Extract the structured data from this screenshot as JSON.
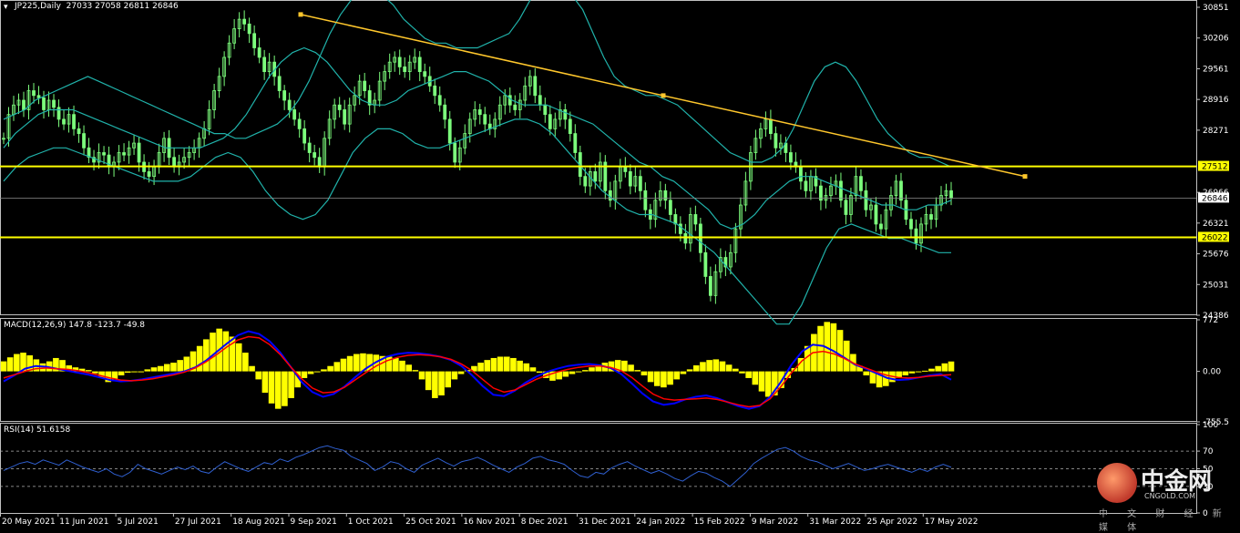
{
  "colors": {
    "background": "#000000",
    "candles": "#7CFC7C",
    "bands": "#20B2AA",
    "levels": "#FFFF00",
    "trendline": "#FFC72C",
    "macd_hist": "#FFFF00",
    "macd_line": "#0000FF",
    "signal_line": "#FF0000",
    "rsi_line": "#2F5FCF"
  },
  "chart_data": [
    {
      "type": "candlestick",
      "title": "JP225,Daily  27033 27058 26811 26846",
      "symbol": "JP225,Daily",
      "ohlc_text": "27033 27058 26811 26846",
      "y_ticks": [
        "30851",
        "30206",
        "29561",
        "28916",
        "28271",
        "27512",
        "26966",
        "26846",
        "26321",
        "26022",
        "25676",
        "25031",
        "24386"
      ],
      "ylim": [
        24386,
        30851
      ],
      "x_ticks": [
        "20 May 2021",
        "11 Jun 2021",
        "5 Jul 2021",
        "27 Jul 2021",
        "18 Aug 2021",
        "9 Sep 2021",
        "1 Oct 2021",
        "25 Oct 2021",
        "16 Nov 2021",
        "8 Dec 2021",
        "31 Dec 2021",
        "24 Jan 2022",
        "15 Feb 2022",
        "9 Mar 2022",
        "31 Mar 2022",
        "25 Apr 2022",
        "17 May 2022"
      ],
      "close_series": [
        28100,
        28600,
        28800,
        28900,
        28700,
        29100,
        29000,
        28950,
        28700,
        28900,
        28750,
        28500,
        28400,
        28600,
        28300,
        28200,
        27900,
        27700,
        27600,
        27800,
        27750,
        27500,
        27600,
        27800,
        27750,
        27900,
        28000,
        27600,
        27400,
        27300,
        27500,
        27800,
        28100,
        27700,
        27500,
        27600,
        27700,
        27800,
        27900,
        28100,
        28300,
        28700,
        29100,
        29400,
        29800,
        30100,
        30400,
        30600,
        30500,
        30300,
        30000,
        29800,
        29500,
        29700,
        29400,
        29100,
        28900,
        28700,
        28500,
        28300,
        28000,
        27800,
        27700,
        27500,
        28100,
        28500,
        28800,
        28700,
        28400,
        28800,
        29000,
        29300,
        29100,
        28800,
        28900,
        29300,
        29500,
        29700,
        29800,
        29600,
        29500,
        29700,
        29800,
        29500,
        29400,
        29200,
        29000,
        28800,
        28500,
        28000,
        27600,
        27900,
        28200,
        28500,
        28700,
        28600,
        28400,
        28300,
        28500,
        28800,
        29000,
        28800,
        28700,
        28900,
        29200,
        29400,
        29000,
        28800,
        28600,
        28300,
        28500,
        28700,
        28500,
        28200,
        27800,
        27300,
        27100,
        27400,
        27200,
        27600,
        27000,
        26800,
        27200,
        27500,
        27400,
        27100,
        27300,
        27000,
        26600,
        26400,
        26800,
        27000,
        26800,
        26500,
        26300,
        26100,
        25900,
        26500,
        26300,
        25700,
        25200,
        24800,
        25300,
        25600,
        25400,
        25700,
        26200,
        26700,
        27200,
        27800,
        28100,
        28300,
        28500,
        28200,
        27900,
        28000,
        27800,
        27600,
        27500,
        27200,
        27000,
        27300,
        27100,
        26800,
        26900,
        27100,
        27200,
        26800,
        26500,
        26900,
        27300,
        27000,
        26600,
        26700,
        26300,
        26200,
        26600,
        26900,
        27200,
        26800,
        26400,
        26200,
        25900,
        26300,
        26500,
        26400,
        26700,
        26900,
        27000,
        26846
      ],
      "upper_band_path": [
        28500,
        28600,
        28700,
        28900,
        29000,
        29100,
        29200,
        29300,
        29400,
        29300,
        29200,
        29100,
        29000,
        28900,
        28800,
        28700,
        28600,
        28500,
        28400,
        28300,
        28200,
        28200,
        28100,
        28100,
        28200,
        28300,
        28400,
        28600,
        28900,
        29300,
        29800,
        30300,
        30700,
        31000,
        31200,
        31200,
        31100,
        30900,
        30600,
        30400,
        30200,
        30100,
        30100,
        30000,
        30000,
        30000,
        30100,
        30200,
        30300,
        30600,
        31000,
        31200,
        31300,
        31300,
        31100,
        30800,
        30300,
        29800,
        29400,
        29200,
        29100,
        29000,
        29000,
        28900,
        28800,
        28600,
        28400,
        28200,
        28000,
        27800,
        27700,
        27600,
        27600,
        27700,
        27900,
        28300,
        28800,
        29300,
        29600,
        29700,
        29600,
        29300,
        28900,
        28500,
        28200,
        28000,
        27800,
        27700,
        27700,
        27600,
        27500
      ],
      "mid_band_path": [
        27900,
        28200,
        28400,
        28600,
        28700,
        28700,
        28700,
        28600,
        28500,
        28400,
        28300,
        28200,
        28100,
        28000,
        27900,
        27900,
        27900,
        27900,
        28000,
        28100,
        28300,
        28600,
        29000,
        29400,
        29700,
        29900,
        30000,
        29900,
        29700,
        29400,
        29100,
        28900,
        28800,
        28800,
        28900,
        29100,
        29200,
        29300,
        29400,
        29500,
        29500,
        29400,
        29300,
        29100,
        28900,
        28800,
        28800,
        28800,
        28700,
        28600,
        28500,
        28400,
        28200,
        28000,
        27800,
        27600,
        27500,
        27300,
        27200,
        27000,
        26800,
        26600,
        26300,
        26200,
        26300,
        26500,
        26800,
        27000,
        27200,
        27300,
        27300,
        27200,
        27100,
        27000,
        26900,
        26800,
        26700,
        26700,
        26600,
        26600,
        26700,
        26700,
        26800
      ],
      "lower_band_path": [
        27200,
        27500,
        27700,
        27800,
        27900,
        27900,
        27800,
        27700,
        27600,
        27500,
        27400,
        27300,
        27200,
        27200,
        27200,
        27300,
        27500,
        27700,
        27800,
        27700,
        27400,
        27000,
        26700,
        26500,
        26400,
        26500,
        26800,
        27300,
        27800,
        28100,
        28300,
        28300,
        28200,
        28000,
        27900,
        27900,
        28000,
        28100,
        28200,
        28300,
        28400,
        28500,
        28500,
        28400,
        28200,
        27900,
        27600,
        27300,
        27000,
        26800,
        26600,
        26500,
        26500,
        26400,
        26300,
        26100,
        25900,
        25700,
        25400,
        25100,
        24800,
        24500,
        24200,
        24200,
        24600,
        25200,
        25800,
        26200,
        26300,
        26200,
        26100,
        26000,
        26000,
        25900,
        25800,
        25700,
        25700
      ],
      "horizontal_levels": [
        {
          "value": 27512,
          "label": "27512"
        },
        {
          "value": 26022,
          "label": "26022"
        }
      ],
      "current_price": {
        "value": 26846,
        "label": "26846"
      },
      "trendline": {
        "from": {
          "date": "9 Sep 2021",
          "value": 30700
        },
        "to": {
          "date": "17 May 2022",
          "value": 27300
        }
      }
    },
    {
      "type": "bar+line",
      "title": "MACD(12,26,9) 147.8 -123.7 -49.8",
      "label": "MACD(12,26,9)",
      "values_text": "147.8 -123.7 -49.8",
      "y_ticks": [
        "772",
        "0.00",
        "-755.5"
      ],
      "ylim": [
        -755.5,
        772
      ],
      "histogram": [
        150,
        210,
        260,
        280,
        240,
        180,
        120,
        150,
        200,
        170,
        90,
        60,
        40,
        20,
        -30,
        -100,
        -160,
        -120,
        -60,
        -20,
        -10,
        0,
        30,
        60,
        80,
        110,
        130,
        170,
        220,
        300,
        380,
        480,
        580,
        640,
        600,
        520,
        420,
        280,
        80,
        -120,
        -320,
        -480,
        -560,
        -520,
        -400,
        -240,
        -100,
        -40,
        -10,
        30,
        80,
        140,
        190,
        230,
        260,
        270,
        260,
        250,
        230,
        220,
        200,
        160,
        100,
        20,
        -120,
        -280,
        -400,
        -360,
        -240,
        -120,
        -40,
        20,
        80,
        130,
        170,
        200,
        220,
        220,
        200,
        160,
        120,
        60,
        -20,
        -100,
        -140,
        -120,
        -80,
        -40,
        -10,
        20,
        60,
        100,
        130,
        150,
        170,
        160,
        100,
        20,
        -60,
        -160,
        -220,
        -240,
        -200,
        -120,
        -40,
        30,
        90,
        140,
        170,
        180,
        150,
        100,
        40,
        -30,
        -100,
        -200,
        -300,
        -380,
        -360,
        -250,
        -100,
        50,
        200,
        380,
        560,
        680,
        740,
        720,
        620,
        460,
        260,
        80,
        -60,
        -180,
        -240,
        -220,
        -160,
        -100,
        -60,
        -30,
        -10,
        10,
        40,
        80,
        120,
        148
      ],
      "macd_line": [
        -150,
        -60,
        40,
        80,
        70,
        40,
        10,
        -20,
        -50,
        -90,
        -130,
        -150,
        -140,
        -120,
        -90,
        -60,
        -30,
        0,
        60,
        160,
        290,
        420,
        540,
        600,
        560,
        450,
        280,
        60,
        -160,
        -310,
        -380,
        -340,
        -230,
        -90,
        40,
        140,
        220,
        260,
        280,
        270,
        250,
        220,
        170,
        80,
        -60,
        -220,
        -350,
        -370,
        -290,
        -170,
        -80,
        -10,
        40,
        80,
        100,
        110,
        90,
        50,
        -40,
        -180,
        -330,
        -450,
        -500,
        -480,
        -420,
        -380,
        -360,
        -400,
        -460,
        -520,
        -560,
        -520,
        -380,
        -160,
        100,
        300,
        400,
        380,
        300,
        200,
        100,
        40,
        -30,
        -100,
        -130,
        -120,
        -90,
        -60,
        -40,
        -123.7
      ],
      "signal_line": [
        -100,
        -50,
        0,
        40,
        50,
        40,
        30,
        10,
        -20,
        -60,
        -100,
        -130,
        -140,
        -130,
        -110,
        -80,
        -50,
        -10,
        50,
        140,
        250,
        370,
        470,
        520,
        500,
        400,
        250,
        60,
        -110,
        -250,
        -320,
        -310,
        -240,
        -130,
        -20,
        80,
        160,
        210,
        240,
        250,
        240,
        220,
        180,
        110,
        10,
        -120,
        -250,
        -310,
        -280,
        -200,
        -120,
        -60,
        -10,
        30,
        60,
        80,
        80,
        60,
        10,
        -90,
        -220,
        -340,
        -410,
        -430,
        -420,
        -410,
        -400,
        -420,
        -460,
        -500,
        -530,
        -510,
        -410,
        -230,
        -20,
        160,
        280,
        300,
        260,
        190,
        110,
        50,
        -10,
        -60,
        -90,
        -100,
        -90,
        -70,
        -60,
        -49.8
      ]
    },
    {
      "type": "line",
      "title": "RSI(14) 51.6158",
      "label": "RSI(14)",
      "value_text": "51.6158",
      "y_ticks": [
        "100",
        "70",
        "50",
        "30",
        "0"
      ],
      "ylim": [
        0,
        100
      ],
      "levels": [
        70,
        50,
        30
      ],
      "values": [
        48,
        52,
        56,
        58,
        55,
        60,
        57,
        54,
        60,
        56,
        52,
        49,
        46,
        50,
        44,
        41,
        46,
        55,
        50,
        47,
        44,
        48,
        52,
        49,
        53,
        47,
        45,
        52,
        58,
        54,
        50,
        47,
        52,
        57,
        55,
        61,
        58,
        63,
        66,
        70,
        74,
        76,
        73,
        71,
        64,
        60,
        56,
        48,
        52,
        58,
        56,
        50,
        46,
        54,
        58,
        62,
        57,
        53,
        58,
        60,
        63,
        59,
        54,
        50,
        46,
        52,
        56,
        62,
        64,
        60,
        58,
        55,
        48,
        42,
        40,
        46,
        44,
        51,
        55,
        58,
        53,
        49,
        45,
        48,
        44,
        39,
        36,
        42,
        47,
        45,
        40,
        36,
        30,
        38,
        46,
        56,
        62,
        67,
        72,
        74,
        70,
        64,
        60,
        58,
        54,
        50,
        53,
        56,
        52,
        48,
        50,
        53,
        55,
        52,
        49,
        46,
        50,
        47,
        52,
        55,
        51.6
      ]
    }
  ],
  "watermark": {
    "brand": "中金网",
    "site": "CNGOLD.COM",
    "tagline": "中 文 财 经 新 媒 体"
  }
}
